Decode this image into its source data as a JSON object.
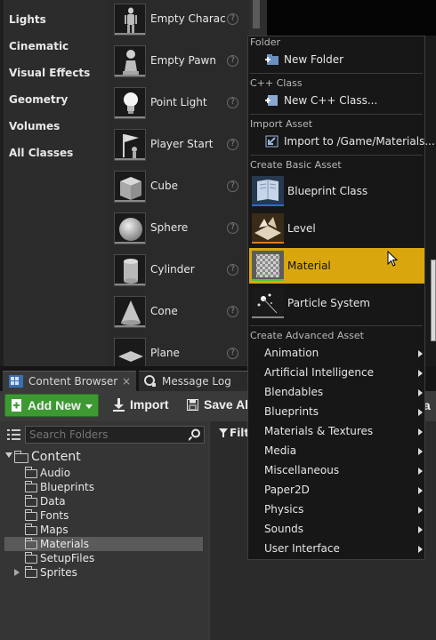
{
  "place_actors": {
    "categories": [
      "Lights",
      "Cinematic",
      "Visual Effects",
      "Geometry",
      "Volumes",
      "All Classes"
    ],
    "items": [
      {
        "label": "Empty Charac",
        "icon": "character-icon"
      },
      {
        "label": "Empty Pawn",
        "icon": "pawn-icon"
      },
      {
        "label": "Point Light",
        "icon": "point-light-icon"
      },
      {
        "label": "Player Start",
        "icon": "player-start-icon"
      },
      {
        "label": "Cube",
        "icon": "cube-icon"
      },
      {
        "label": "Sphere",
        "icon": "sphere-icon"
      },
      {
        "label": "Cylinder",
        "icon": "cylinder-icon"
      },
      {
        "label": "Cone",
        "icon": "cone-icon"
      },
      {
        "label": "Plane",
        "icon": "plane-icon"
      }
    ],
    "help_glyph": "?"
  },
  "tabs": [
    {
      "label": "Content Browser",
      "close": "×"
    },
    {
      "label": "Message Log"
    }
  ],
  "toolbar": {
    "add_new": "Add New",
    "import": "Import",
    "save_all": "Save Al",
    "filters": "Filte",
    "right_clip": "la"
  },
  "sources": {
    "search_placeholder": "Search Folders",
    "root": "Content",
    "folders": [
      "Audio",
      "Blueprints",
      "Data",
      "Fonts",
      "Maps",
      "Materials",
      "SetupFiles",
      "Sprites"
    ],
    "selected": "Materials"
  },
  "context_menu": {
    "sections": {
      "folder": "Folder",
      "cpp": "C++ Class",
      "import": "Import Asset",
      "basic": "Create Basic Asset",
      "advanced": "Create Advanced Asset"
    },
    "new_folder": "New Folder",
    "new_cpp": "New C++ Class...",
    "import_to": "Import to /Game/Materials...",
    "basic_assets": [
      {
        "label": "Blueprint Class",
        "icon": "blueprint-class-icon"
      },
      {
        "label": "Level",
        "icon": "level-icon"
      },
      {
        "label": "Material",
        "icon": "material-icon"
      },
      {
        "label": "Particle System",
        "icon": "particle-system-icon"
      }
    ],
    "highlighted": "Material",
    "advanced_assets": [
      "Animation",
      "Artificial Intelligence",
      "Blendables",
      "Blueprints",
      "Materials & Textures",
      "Media",
      "Miscellaneous",
      "Paper2D",
      "Physics",
      "Sounds",
      "User Interface"
    ]
  },
  "colors": {
    "highlight": "#d9a70d",
    "add_new_green": "#3d9a32",
    "selected_folder": "#5a5a5a"
  }
}
